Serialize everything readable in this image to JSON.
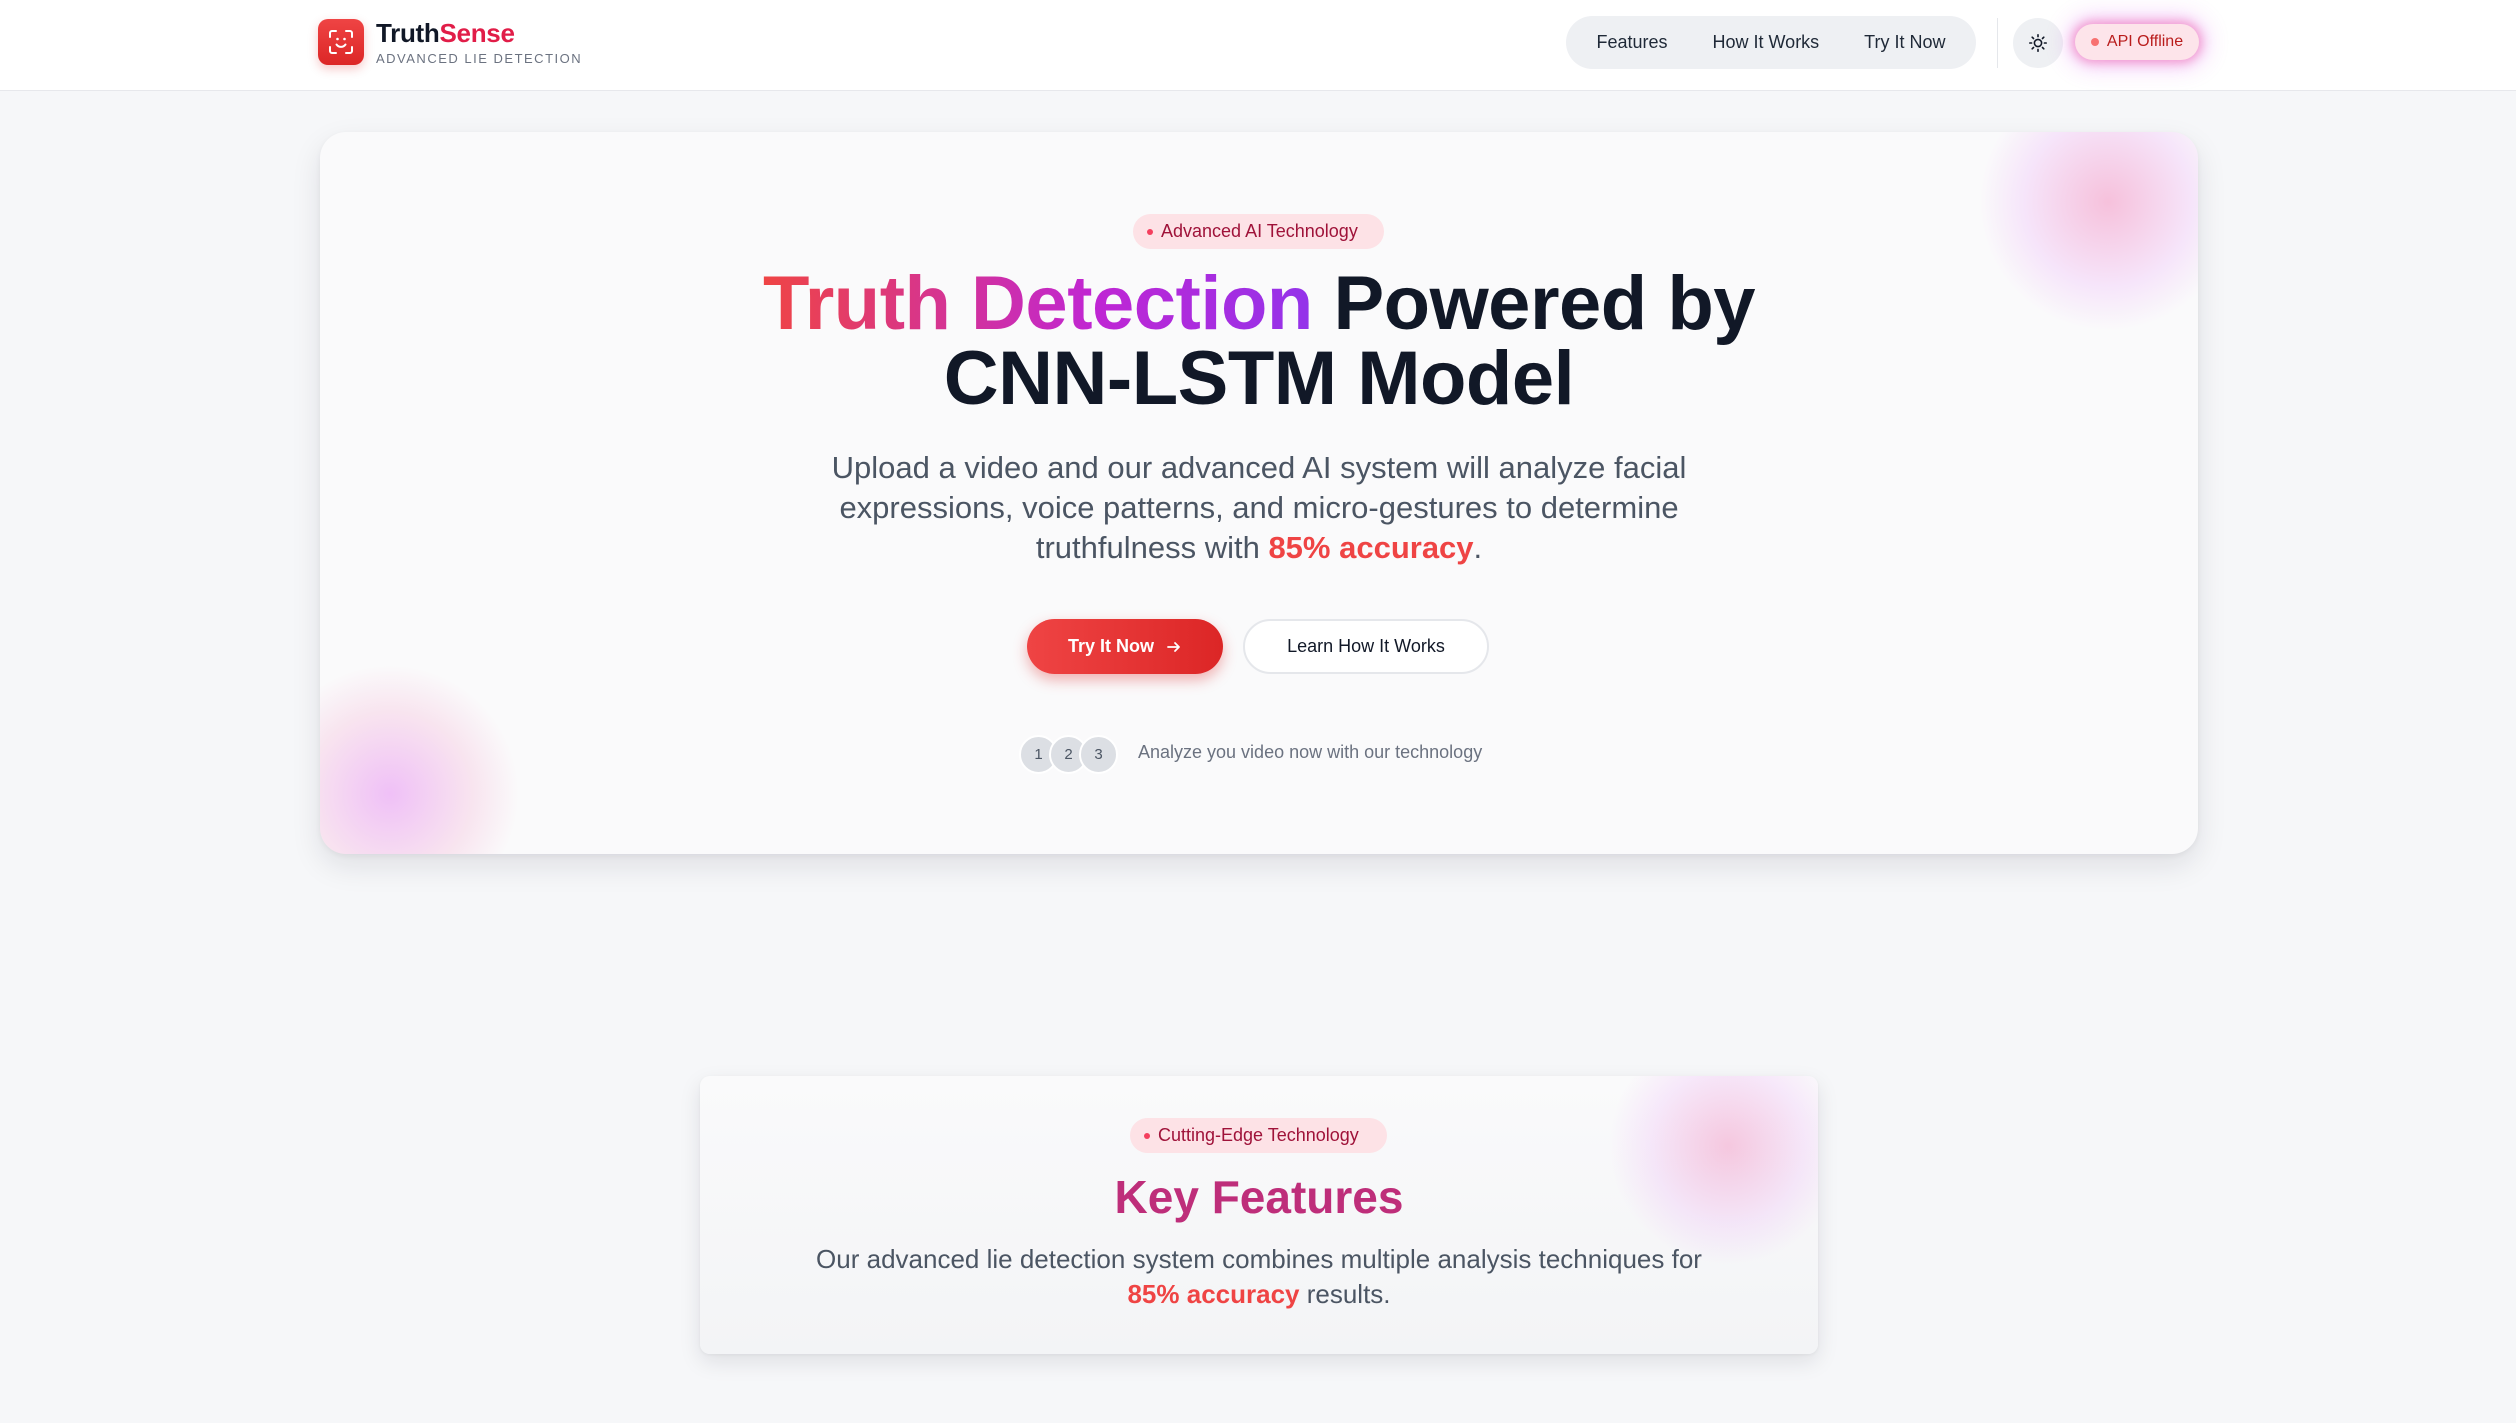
{
  "header": {
    "brand_part1": "Truth",
    "brand_part2": "Sense",
    "tagline": "ADVANCED LIE DETECTION",
    "nav": [
      "Features",
      "How It Works",
      "Try It Now"
    ],
    "theme_toggle_icon": "sun-icon",
    "api_status": "API Offline"
  },
  "hero": {
    "badge": "Advanced AI Technology",
    "title_gradient": "Truth Detection",
    "title_rest": "Powered by",
    "title_line2": "CNN-LSTM Model",
    "desc_before": "Upload a video and our advanced AI system will analyze facial expressions, voice patterns, and micro-gestures to determine truthfulness with ",
    "desc_accent": "85% accuracy",
    "desc_after": ".",
    "primary_button": "Try It Now",
    "secondary_button": "Learn How It Works",
    "steps": [
      "1",
      "2",
      "3"
    ],
    "steps_text": "Analyze you video now with our technology"
  },
  "features": {
    "badge": "Cutting-Edge Technology",
    "title": "Key Features",
    "desc_before": "Our advanced lie detection system combines multiple analysis techniques for ",
    "desc_accent": "85% accuracy",
    "desc_after": " results."
  },
  "colors": {
    "accent_red": "#ef4444",
    "brand_pink": "#e11d48",
    "gradient_purple": "#9333ea",
    "features_title": "#be2e7a",
    "page_background": "#f6f7f9"
  }
}
